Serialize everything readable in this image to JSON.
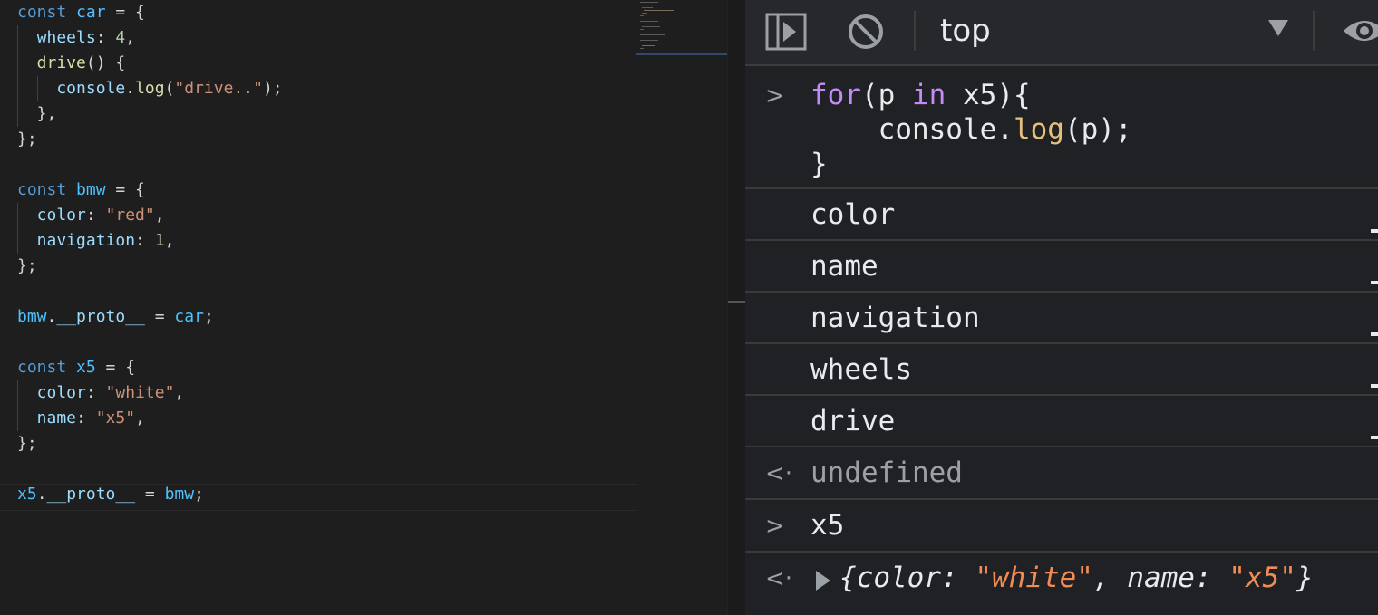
{
  "editor": {
    "lines": [
      [
        {
          "t": "const ",
          "c": "kw"
        },
        {
          "t": "car",
          "c": "obj"
        },
        {
          "t": " = {",
          "c": "pn"
        }
      ],
      [
        {
          "t": "  wheels",
          "c": "prop"
        },
        {
          "t": ": ",
          "c": "pn"
        },
        {
          "t": "4",
          "c": "num"
        },
        {
          "t": ",",
          "c": "pn"
        }
      ],
      [
        {
          "t": "  drive",
          "c": "fn"
        },
        {
          "t": "() {",
          "c": "pn"
        }
      ],
      [
        {
          "t": "    console",
          "c": "prop"
        },
        {
          "t": ".",
          "c": "pn"
        },
        {
          "t": "log",
          "c": "fn"
        },
        {
          "t": "(",
          "c": "pn"
        },
        {
          "t": "\"drive..\"",
          "c": "str"
        },
        {
          "t": ");",
          "c": "pn"
        }
      ],
      [
        {
          "t": "  },",
          "c": "pn"
        }
      ],
      [
        {
          "t": "};",
          "c": "pn"
        }
      ],
      [],
      [
        {
          "t": "const ",
          "c": "kw"
        },
        {
          "t": "bmw",
          "c": "obj"
        },
        {
          "t": " = {",
          "c": "pn"
        }
      ],
      [
        {
          "t": "  color",
          "c": "prop"
        },
        {
          "t": ": ",
          "c": "pn"
        },
        {
          "t": "\"red\"",
          "c": "str"
        },
        {
          "t": ",",
          "c": "pn"
        }
      ],
      [
        {
          "t": "  navigation",
          "c": "prop"
        },
        {
          "t": ": ",
          "c": "pn"
        },
        {
          "t": "1",
          "c": "num"
        },
        {
          "t": ",",
          "c": "pn"
        }
      ],
      [
        {
          "t": "};",
          "c": "pn"
        }
      ],
      [],
      [
        {
          "t": "bmw",
          "c": "obj"
        },
        {
          "t": ".",
          "c": "pn"
        },
        {
          "t": "__proto__",
          "c": "prop"
        },
        {
          "t": " = ",
          "c": "pn"
        },
        {
          "t": "car",
          "c": "obj"
        },
        {
          "t": ";",
          "c": "pn"
        }
      ],
      [],
      [
        {
          "t": "const ",
          "c": "kw"
        },
        {
          "t": "x5",
          "c": "obj"
        },
        {
          "t": " = {",
          "c": "pn"
        }
      ],
      [
        {
          "t": "  color",
          "c": "prop"
        },
        {
          "t": ": ",
          "c": "pn"
        },
        {
          "t": "\"white\"",
          "c": "str"
        },
        {
          "t": ",",
          "c": "pn"
        }
      ],
      [
        {
          "t": "  name",
          "c": "prop"
        },
        {
          "t": ": ",
          "c": "pn"
        },
        {
          "t": "\"x5\"",
          "c": "str"
        },
        {
          "t": ",",
          "c": "pn"
        }
      ],
      [
        {
          "t": "};",
          "c": "pn"
        }
      ],
      [],
      [
        {
          "t": "x5",
          "c": "obj"
        },
        {
          "t": ".",
          "c": "pn"
        },
        {
          "t": "__proto__",
          "c": "prop"
        },
        {
          "t": " = ",
          "c": "pn"
        },
        {
          "t": "bmw",
          "c": "obj"
        },
        {
          "t": ";",
          "c": "pn"
        }
      ]
    ]
  },
  "console": {
    "toolbar": {
      "context": "top",
      "sidebar_icon": "sidebar-toggle-icon",
      "clear_icon": "clear-console-icon",
      "dropdown_icon": "chevron-down-icon",
      "live_expression_icon": "eye-icon"
    },
    "input1": {
      "prompt": ">",
      "line1": [
        {
          "t": "for",
          "c": "c-kw"
        },
        {
          "t": "(p ",
          "c": "c-plain"
        },
        {
          "t": "in",
          "c": "c-kw"
        },
        {
          "t": " x5){",
          "c": "c-plain"
        }
      ],
      "line2": [
        {
          "t": "    console.",
          "c": "c-plain"
        },
        {
          "t": "log",
          "c": "c-fn"
        },
        {
          "t": "(p);",
          "c": "c-plain"
        }
      ],
      "line3": [
        {
          "t": "}",
          "c": "c-plain"
        }
      ]
    },
    "logs": [
      "color",
      "name",
      "navigation",
      "wheels",
      "drive"
    ],
    "result1": {
      "prompt": "<·",
      "text": "undefined"
    },
    "input2": {
      "prompt": ">",
      "text": "x5"
    },
    "result2": {
      "prompt": "<·",
      "segments": [
        {
          "t": "{color: ",
          "c": "c-plain"
        },
        {
          "t": "\"white\"",
          "c": "c-str"
        },
        {
          "t": ", name: ",
          "c": "c-plain"
        },
        {
          "t": "\"x5\"",
          "c": "c-str"
        },
        {
          "t": "}",
          "c": "c-plain"
        }
      ]
    },
    "colors": {
      "keyword": "#c58af9",
      "function": "#e5c07b",
      "string": "#f28b54",
      "background": "#202124"
    }
  }
}
